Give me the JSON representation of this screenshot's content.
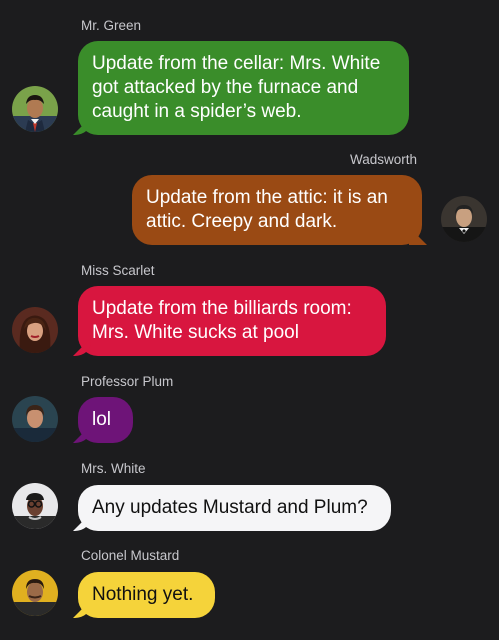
{
  "colors": {
    "background": "#1c1c1e",
    "green": "#3a8d2a",
    "orange": "#9a4a14",
    "red": "#d8163f",
    "purple": "#6e1478",
    "white": "#f5f5f7",
    "yellow": "#f5d33a",
    "sender_text": "#c7c7cc"
  },
  "messages": [
    {
      "sender": "Mr. Green",
      "text": "Update from the cellar: Mrs. White got attacked by the furnace and caught in a spider’s web.",
      "side": "left",
      "avatar_icon": "mr-green-avatar-icon"
    },
    {
      "sender": "Wadsworth",
      "text": "Update from the attic: it is an attic. Creepy and dark.",
      "side": "right",
      "avatar_icon": "wadsworth-avatar-icon"
    },
    {
      "sender": "Miss Scarlet",
      "text": "Update from the billiards room: Mrs. White sucks at pool",
      "side": "left",
      "avatar_icon": "miss-scarlet-avatar-icon"
    },
    {
      "sender": "Professor Plum",
      "text": "lol",
      "side": "left",
      "avatar_icon": "professor-plum-avatar-icon"
    },
    {
      "sender": "Mrs. White",
      "text": "Any updates Mustard and Plum?",
      "side": "left",
      "avatar_icon": "mrs-white-avatar-icon"
    },
    {
      "sender": "Colonel Mustard",
      "text": "Nothing yet.",
      "side": "left",
      "avatar_icon": "colonel-mustard-avatar-icon"
    }
  ]
}
